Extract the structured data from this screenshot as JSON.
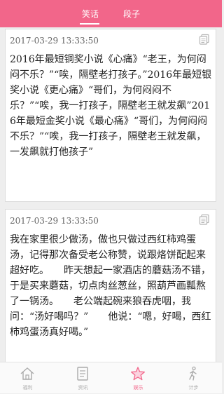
{
  "header": {
    "tabs": [
      {
        "label": "笑话",
        "active": true
      },
      {
        "label": "段子",
        "active": false
      }
    ],
    "accent_color": "#f2668a"
  },
  "cards": [
    {
      "time": "2017-03-29 13:33:50",
      "text": "2016年最短铜奖小说《心痛》“老王，为何闷闷不乐？”“唉，隔壁老打孩子。”2016年最短银奖小说《更心痛》“哥们，为何闷闷不乐？”“唉，我一打孩子，隔壁老王就发飙”2016年最短金奖小说《最心痛》“哥们，为何闷闷不乐？”“唉，我一打孩子，隔壁老王就发飙，一发飙就打他孩子”",
      "icon": "copy-icon"
    },
    {
      "time": "2017-03-29 13:33:50",
      "text": "我在家里很少做汤，做也只做过西红柿鸡蛋汤，记得那次备受老公称赞，说跟烙饼配起来超好吃。　　昨天想起一家酒店的蘑菇汤不错，于是买来蘑菇，切点肉丝葱丝，照葫芦画瓢熬了一锅汤。　　老公端起碗来狼吞虎咽，我问：“汤好喝吗？”　　他说：“嗯，好喝，西红柿鸡蛋汤真好喝。”",
      "icon": "copy-icon"
    }
  ],
  "bottom_nav": [
    {
      "label": "福利",
      "icon": "home-icon",
      "active": false
    },
    {
      "label": "资讯",
      "icon": "news-icon",
      "active": false
    },
    {
      "label": "娱乐",
      "icon": "star-icon",
      "active": true
    },
    {
      "label": "计步",
      "icon": "walk-icon",
      "active": false
    }
  ]
}
